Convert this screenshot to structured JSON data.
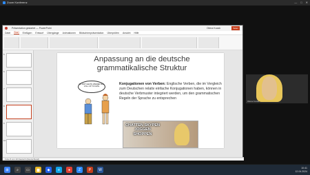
{
  "zoom": {
    "title": "Zoom Konferenz",
    "icons": [
      "minimize-icon",
      "maximize-icon",
      "close-icon"
    ]
  },
  "powerpoint": {
    "window_title": "Präsentation gestartet — PowerPoint",
    "user": "Olena Kozak",
    "share_label": "Teilen",
    "menu": [
      "Datei",
      "Start",
      "Einfügen",
      "Entwurf",
      "Übergänge",
      "Animationen",
      "Bildschirmpräsentation",
      "Überprüfen",
      "Ansicht",
      "Hilfe"
    ],
    "active_menu": "Start",
    "thumbnail_numbers": [
      "5",
      "6",
      "7",
      "8",
      "9",
      "10"
    ],
    "status_text": "Folie 8 von 10   Deutsch (Deutschland)"
  },
  "slide": {
    "title": "Anpassung an die deutsche grammatikalische Struktur",
    "bold_lead": "Konjugationen von Verben:",
    "body": " Englische Verben, die im Vergleich zum Deutschen relativ einfache Konjugationen haben, können in deutsche Verbmuster integriert werden, um den grammatischen Regeln der Sprache zu entsprechen",
    "bubble": "DU BIST HEUTE WIEDER MAL VOLL UP TO DATE",
    "photo_words": "CHATTEN SKYPEN JOGGEN SHOPPEN"
  },
  "camera": {
    "name": "Olena Kozak"
  },
  "taskbar": {
    "time": "10:41",
    "date": "12.04.2024",
    "apps": [
      "start-icon",
      "search-icon",
      "task-view-icon",
      "explorer-icon",
      "store-icon",
      "edge-icon",
      "chrome-icon",
      "zoom-icon",
      "powerpoint-icon",
      "word-icon"
    ]
  }
}
